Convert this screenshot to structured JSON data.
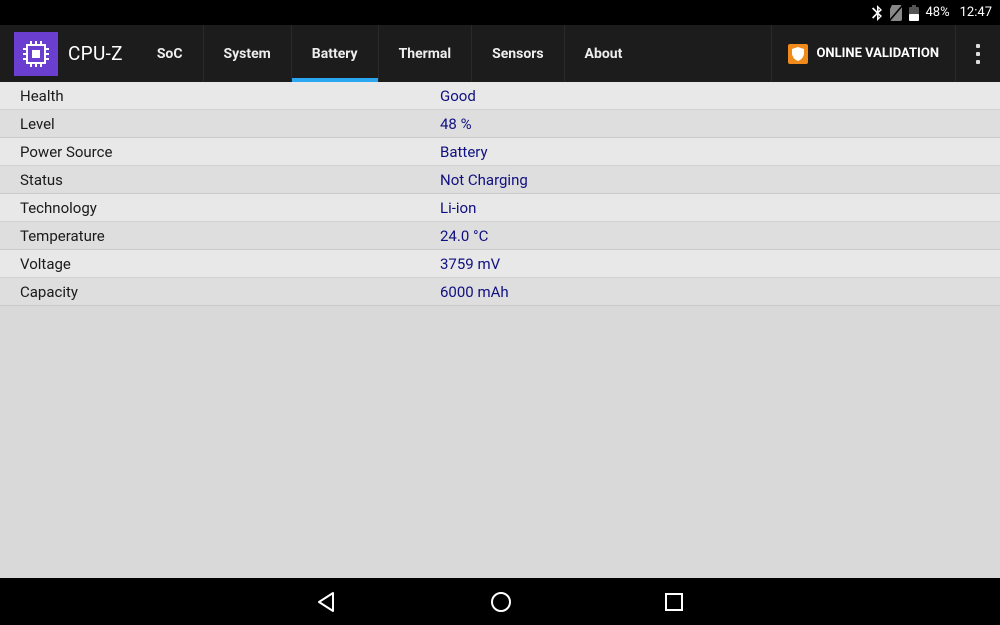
{
  "status_bar": {
    "battery_pct": "48%",
    "clock": "12:47"
  },
  "app": {
    "title": "CPU-Z",
    "validation_label": "ONLINE VALIDATION"
  },
  "tabs": [
    {
      "label": "SoC",
      "active": false
    },
    {
      "label": "System",
      "active": false
    },
    {
      "label": "Battery",
      "active": true
    },
    {
      "label": "Thermal",
      "active": false
    },
    {
      "label": "Sensors",
      "active": false
    },
    {
      "label": "About",
      "active": false
    }
  ],
  "rows": [
    {
      "label": "Health",
      "value": "Good"
    },
    {
      "label": "Level",
      "value": "48 %"
    },
    {
      "label": "Power Source",
      "value": "Battery"
    },
    {
      "label": "Status",
      "value": "Not Charging"
    },
    {
      "label": "Technology",
      "value": "Li-ion"
    },
    {
      "label": "Temperature",
      "value": "24.0 °C"
    },
    {
      "label": "Voltage",
      "value": "3759 mV"
    },
    {
      "label": "Capacity",
      "value": "6000 mAh"
    }
  ]
}
